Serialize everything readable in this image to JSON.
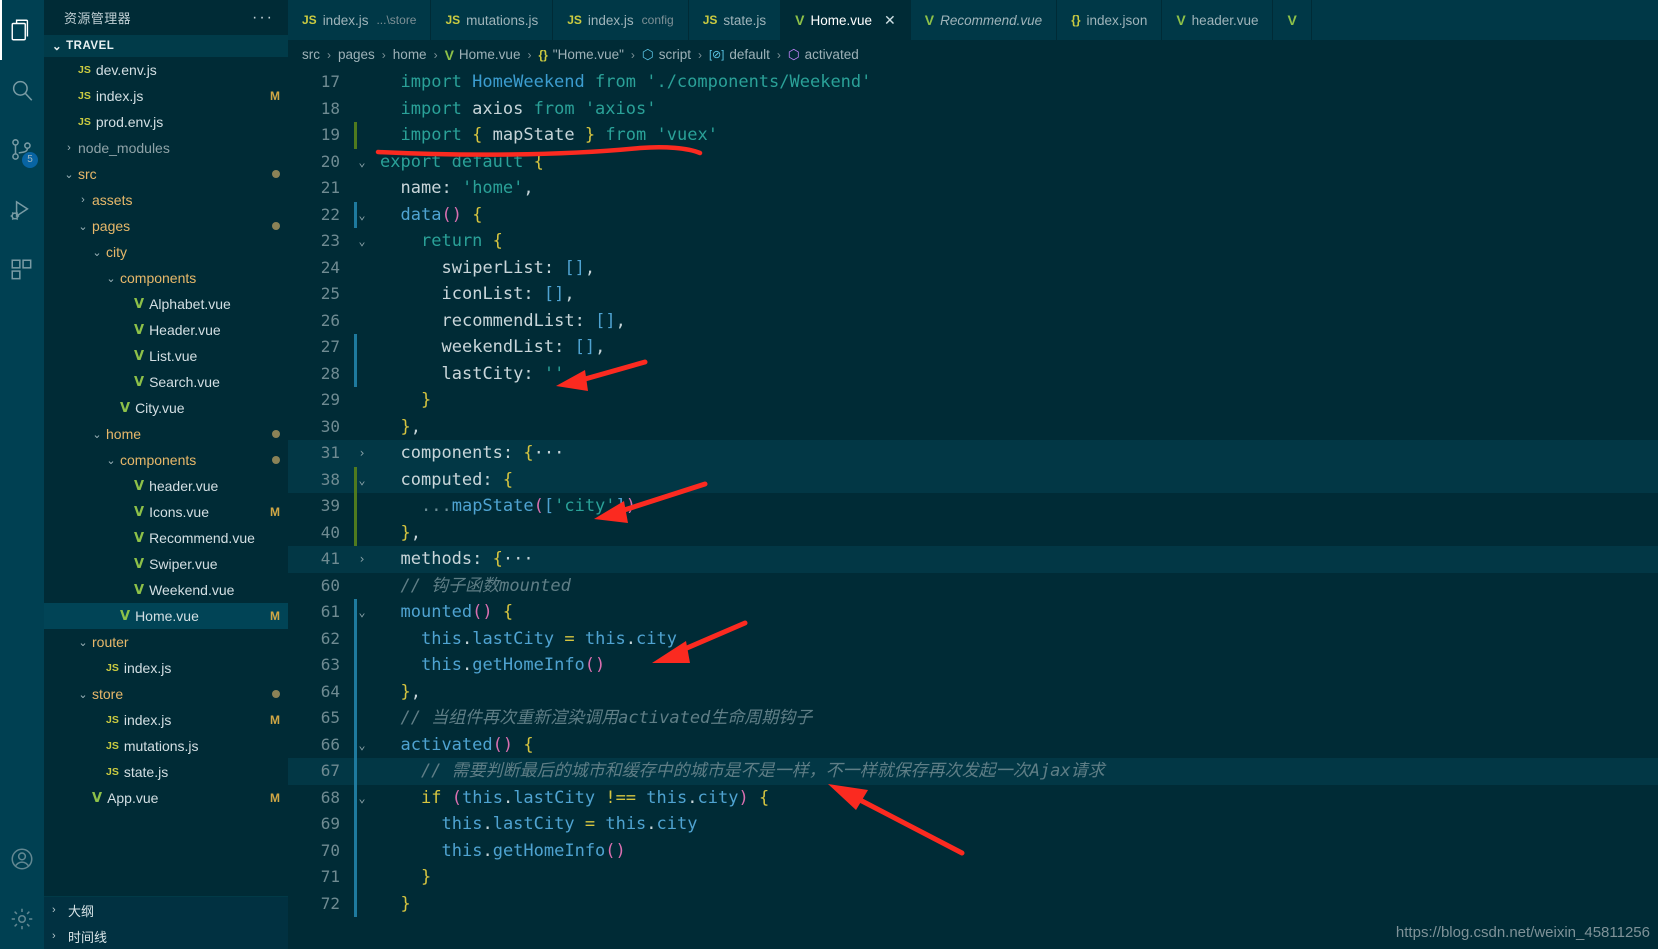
{
  "window": {
    "watermark": "https://blog.csdn.net/weixin_45811256"
  },
  "activity_bar": {
    "items": [
      {
        "name": "explorer-icon",
        "label": "资源管理器",
        "active": true,
        "badge": ""
      },
      {
        "name": "search-icon",
        "label": "搜索",
        "active": false,
        "badge": ""
      },
      {
        "name": "source-control-icon",
        "label": "源代码管理",
        "active": false,
        "badge": "5"
      },
      {
        "name": "run-debug-icon",
        "label": "运行和调试",
        "active": false,
        "badge": ""
      },
      {
        "name": "extensions-icon",
        "label": "扩展",
        "active": false,
        "badge": ""
      }
    ],
    "bottom_items": [
      {
        "name": "account-icon",
        "label": "账户"
      },
      {
        "name": "settings-gear-icon",
        "label": "管理"
      }
    ]
  },
  "sidebar": {
    "title": "资源管理器",
    "more_actions": "···",
    "folder": "TRAVEL",
    "tree": [
      {
        "indent": 1,
        "chev": "",
        "ftype": "js",
        "label": "dev.env.js",
        "mark": "",
        "dot": false,
        "selected": false
      },
      {
        "indent": 1,
        "chev": "",
        "ftype": "js",
        "label": "index.js",
        "mark": "M",
        "dot": false,
        "selected": false
      },
      {
        "indent": 1,
        "chev": "",
        "ftype": "js",
        "label": "prod.env.js",
        "mark": "",
        "dot": false,
        "selected": false
      },
      {
        "indent": 1,
        "chev": "›",
        "ftype": "",
        "label": "node_modules",
        "mark": "",
        "dot": false,
        "selected": false,
        "dim": true
      },
      {
        "indent": 1,
        "chev": "⌄",
        "ftype": "",
        "label": "src",
        "mark": "",
        "dot": true,
        "selected": false,
        "folder": false
      },
      {
        "indent": 2,
        "chev": "›",
        "ftype": "",
        "label": "assets",
        "mark": "",
        "dot": false,
        "selected": false
      },
      {
        "indent": 2,
        "chev": "⌄",
        "ftype": "",
        "label": "pages",
        "mark": "",
        "dot": true,
        "selected": false,
        "folder": true
      },
      {
        "indent": 3,
        "chev": "⌄",
        "ftype": "",
        "label": "city",
        "mark": "",
        "dot": false,
        "selected": false
      },
      {
        "indent": 4,
        "chev": "⌄",
        "ftype": "",
        "label": "components",
        "mark": "",
        "dot": false,
        "selected": false
      },
      {
        "indent": 5,
        "chev": "",
        "ftype": "vue",
        "label": "Alphabet.vue",
        "mark": "",
        "dot": false,
        "selected": false
      },
      {
        "indent": 5,
        "chev": "",
        "ftype": "vue",
        "label": "Header.vue",
        "mark": "",
        "dot": false,
        "selected": false
      },
      {
        "indent": 5,
        "chev": "",
        "ftype": "vue",
        "label": "List.vue",
        "mark": "",
        "dot": false,
        "selected": false
      },
      {
        "indent": 5,
        "chev": "",
        "ftype": "vue",
        "label": "Search.vue",
        "mark": "",
        "dot": false,
        "selected": false
      },
      {
        "indent": 4,
        "chev": "",
        "ftype": "vue",
        "label": "City.vue",
        "mark": "",
        "dot": false,
        "selected": false
      },
      {
        "indent": 3,
        "chev": "⌄",
        "ftype": "",
        "label": "home",
        "mark": "",
        "dot": true,
        "selected": false
      },
      {
        "indent": 4,
        "chev": "⌄",
        "ftype": "",
        "label": "components",
        "mark": "",
        "dot": true,
        "selected": false,
        "folder": true
      },
      {
        "indent": 5,
        "chev": "",
        "ftype": "vue",
        "label": "header.vue",
        "mark": "",
        "dot": false,
        "selected": false
      },
      {
        "indent": 5,
        "chev": "",
        "ftype": "vue",
        "label": "Icons.vue",
        "mark": "M",
        "dot": false,
        "selected": false,
        "folder": true
      },
      {
        "indent": 5,
        "chev": "",
        "ftype": "vue",
        "label": "Recommend.vue",
        "mark": "",
        "dot": false,
        "selected": false
      },
      {
        "indent": 5,
        "chev": "",
        "ftype": "vue",
        "label": "Swiper.vue",
        "mark": "",
        "dot": false,
        "selected": false
      },
      {
        "indent": 5,
        "chev": "",
        "ftype": "vue",
        "label": "Weekend.vue",
        "mark": "",
        "dot": false,
        "selected": false
      },
      {
        "indent": 4,
        "chev": "",
        "ftype": "vue",
        "label": "Home.vue",
        "mark": "M",
        "dot": false,
        "selected": true,
        "folder": true
      },
      {
        "indent": 2,
        "chev": "⌄",
        "ftype": "",
        "label": "router",
        "mark": "",
        "dot": false,
        "selected": false
      },
      {
        "indent": 3,
        "chev": "",
        "ftype": "js",
        "label": "index.js",
        "mark": "",
        "dot": false,
        "selected": false
      },
      {
        "indent": 2,
        "chev": "⌄",
        "ftype": "",
        "label": "store",
        "mark": "",
        "dot": true,
        "selected": false,
        "folder": true
      },
      {
        "indent": 3,
        "chev": "",
        "ftype": "js",
        "label": "index.js",
        "mark": "M",
        "dot": false,
        "selected": false,
        "folder": true
      },
      {
        "indent": 3,
        "chev": "",
        "ftype": "js",
        "label": "mutations.js",
        "mark": "",
        "dot": false,
        "selected": false
      },
      {
        "indent": 3,
        "chev": "",
        "ftype": "js",
        "label": "state.js",
        "mark": "",
        "dot": false,
        "selected": false
      },
      {
        "indent": 2,
        "chev": "",
        "ftype": "vue",
        "label": "App.vue",
        "mark": "M",
        "dot": false,
        "selected": false,
        "folder": true
      }
    ],
    "bottom_panels": [
      {
        "label": "大纲",
        "chev": "›"
      },
      {
        "label": "时间线",
        "chev": "›"
      }
    ]
  },
  "tabs": [
    {
      "ftype": "js",
      "name": "index.js",
      "sub": "...\\store",
      "active": false,
      "italic": false,
      "close": false
    },
    {
      "ftype": "js",
      "name": "mutations.js",
      "sub": "",
      "active": false,
      "italic": false,
      "close": false
    },
    {
      "ftype": "js",
      "name": "index.js",
      "sub": "config",
      "active": false,
      "italic": false,
      "close": false
    },
    {
      "ftype": "js",
      "name": "state.js",
      "sub": "",
      "active": false,
      "italic": false,
      "close": false
    },
    {
      "ftype": "vue",
      "name": "Home.vue",
      "sub": "",
      "active": true,
      "italic": false,
      "close": true
    },
    {
      "ftype": "vue",
      "name": "Recommend.vue",
      "sub": "",
      "active": false,
      "italic": true,
      "close": false
    },
    {
      "ftype": "json",
      "name": "index.json",
      "sub": "",
      "active": false,
      "italic": false,
      "close": false
    },
    {
      "ftype": "vue",
      "name": "header.vue",
      "sub": "",
      "active": false,
      "italic": false,
      "close": false
    }
  ],
  "breadcrumb": [
    {
      "icon": "",
      "label": "src"
    },
    {
      "icon": "",
      "label": "pages"
    },
    {
      "icon": "",
      "label": "home"
    },
    {
      "icon": "vue",
      "label": "Home.vue"
    },
    {
      "icon": "json",
      "label": "\"Home.vue\""
    },
    {
      "icon": "cube",
      "label": "script"
    },
    {
      "icon": "sq",
      "label": "default"
    },
    {
      "icon": "purple-cube",
      "label": "activated"
    }
  ],
  "code": {
    "language": "vue",
    "lines": [
      {
        "n": 17,
        "fold": "",
        "gutter": "",
        "hl": false,
        "text": "  import HomeWeekend from './components/Weekend'"
      },
      {
        "n": 18,
        "fold": "",
        "gutter": "",
        "hl": false,
        "text": "  import axios from 'axios'"
      },
      {
        "n": 19,
        "fold": "",
        "gutter": "green",
        "hl": false,
        "text": "  import { mapState } from 'vuex'"
      },
      {
        "n": 20,
        "fold": "⌄",
        "gutter": "",
        "hl": false,
        "text": "export default {"
      },
      {
        "n": 21,
        "fold": "",
        "gutter": "",
        "hl": false,
        "text": "  name: 'home',"
      },
      {
        "n": 22,
        "fold": "⌄",
        "gutter": "blue",
        "hl": false,
        "text": "  data() {"
      },
      {
        "n": 23,
        "fold": "⌄",
        "gutter": "",
        "hl": false,
        "text": "    return {"
      },
      {
        "n": 24,
        "fold": "",
        "gutter": "",
        "hl": false,
        "text": "      swiperList: [],"
      },
      {
        "n": 25,
        "fold": "",
        "gutter": "",
        "hl": false,
        "text": "      iconList: [],"
      },
      {
        "n": 26,
        "fold": "",
        "gutter": "",
        "hl": false,
        "text": "      recommendList: [],"
      },
      {
        "n": 27,
        "fold": "",
        "gutter": "blue",
        "hl": false,
        "text": "      weekendList: [],"
      },
      {
        "n": 28,
        "fold": "",
        "gutter": "blue",
        "hl": false,
        "text": "      lastCity: ''"
      },
      {
        "n": 29,
        "fold": "",
        "gutter": "",
        "hl": false,
        "text": "    }"
      },
      {
        "n": 30,
        "fold": "",
        "gutter": "",
        "hl": false,
        "text": "  },"
      },
      {
        "n": 31,
        "fold": "›",
        "gutter": "",
        "hl": true,
        "text": "  components: {···"
      },
      {
        "n": 38,
        "fold": "⌄",
        "gutter": "green",
        "hl": true,
        "text": "  computed: {"
      },
      {
        "n": 39,
        "fold": "",
        "gutter": "green",
        "hl": false,
        "text": "    ...mapState(['city'])"
      },
      {
        "n": 40,
        "fold": "",
        "gutter": "green",
        "hl": false,
        "text": "  },"
      },
      {
        "n": 41,
        "fold": "›",
        "gutter": "",
        "hl": true,
        "text": "  methods: {···"
      },
      {
        "n": 60,
        "fold": "",
        "gutter": "",
        "hl": false,
        "text": "  // 钩子函数mounted"
      },
      {
        "n": 61,
        "fold": "⌄",
        "gutter": "blue",
        "hl": false,
        "text": "  mounted() {"
      },
      {
        "n": 62,
        "fold": "",
        "gutter": "blue",
        "hl": false,
        "text": "    this.lastCity = this.city"
      },
      {
        "n": 63,
        "fold": "",
        "gutter": "blue",
        "hl": false,
        "text": "    this.getHomeInfo()"
      },
      {
        "n": 64,
        "fold": "",
        "gutter": "blue",
        "hl": false,
        "text": "  },"
      },
      {
        "n": 65,
        "fold": "",
        "gutter": "blue",
        "hl": false,
        "text": "  // 当组件再次重新渲染调用activated生命周期钩子"
      },
      {
        "n": 66,
        "fold": "⌄",
        "gutter": "blue",
        "hl": false,
        "text": "  activated() {"
      },
      {
        "n": 67,
        "fold": "",
        "gutter": "blue",
        "hl": true,
        "text": "    // 需要判断最后的城市和缓存中的城市是不是一样，不一样就保存再次发起一次Ajax请求"
      },
      {
        "n": 68,
        "fold": "⌄",
        "gutter": "blue",
        "hl": false,
        "text": "    if (this.lastCity !== this.city) {"
      },
      {
        "n": 69,
        "fold": "",
        "gutter": "blue",
        "hl": false,
        "text": "      this.lastCity = this.city"
      },
      {
        "n": 70,
        "fold": "",
        "gutter": "blue",
        "hl": false,
        "text": "      this.getHomeInfo()"
      },
      {
        "n": 71,
        "fold": "",
        "gutter": "blue",
        "hl": false,
        "text": "    }"
      },
      {
        "n": 72,
        "fold": "",
        "gutter": "blue",
        "hl": false,
        "text": "  }"
      }
    ]
  },
  "annotations": {
    "color": "#fb2a20",
    "items": [
      {
        "name": "underline-import-mapstate",
        "type": "underline"
      },
      {
        "name": "arrow-lastcity",
        "type": "arrow"
      },
      {
        "name": "arrow-mapstate-city",
        "type": "arrow"
      },
      {
        "name": "arrow-gethomeinfo",
        "type": "arrow"
      },
      {
        "name": "arrow-if-lastcity",
        "type": "arrow"
      }
    ]
  }
}
